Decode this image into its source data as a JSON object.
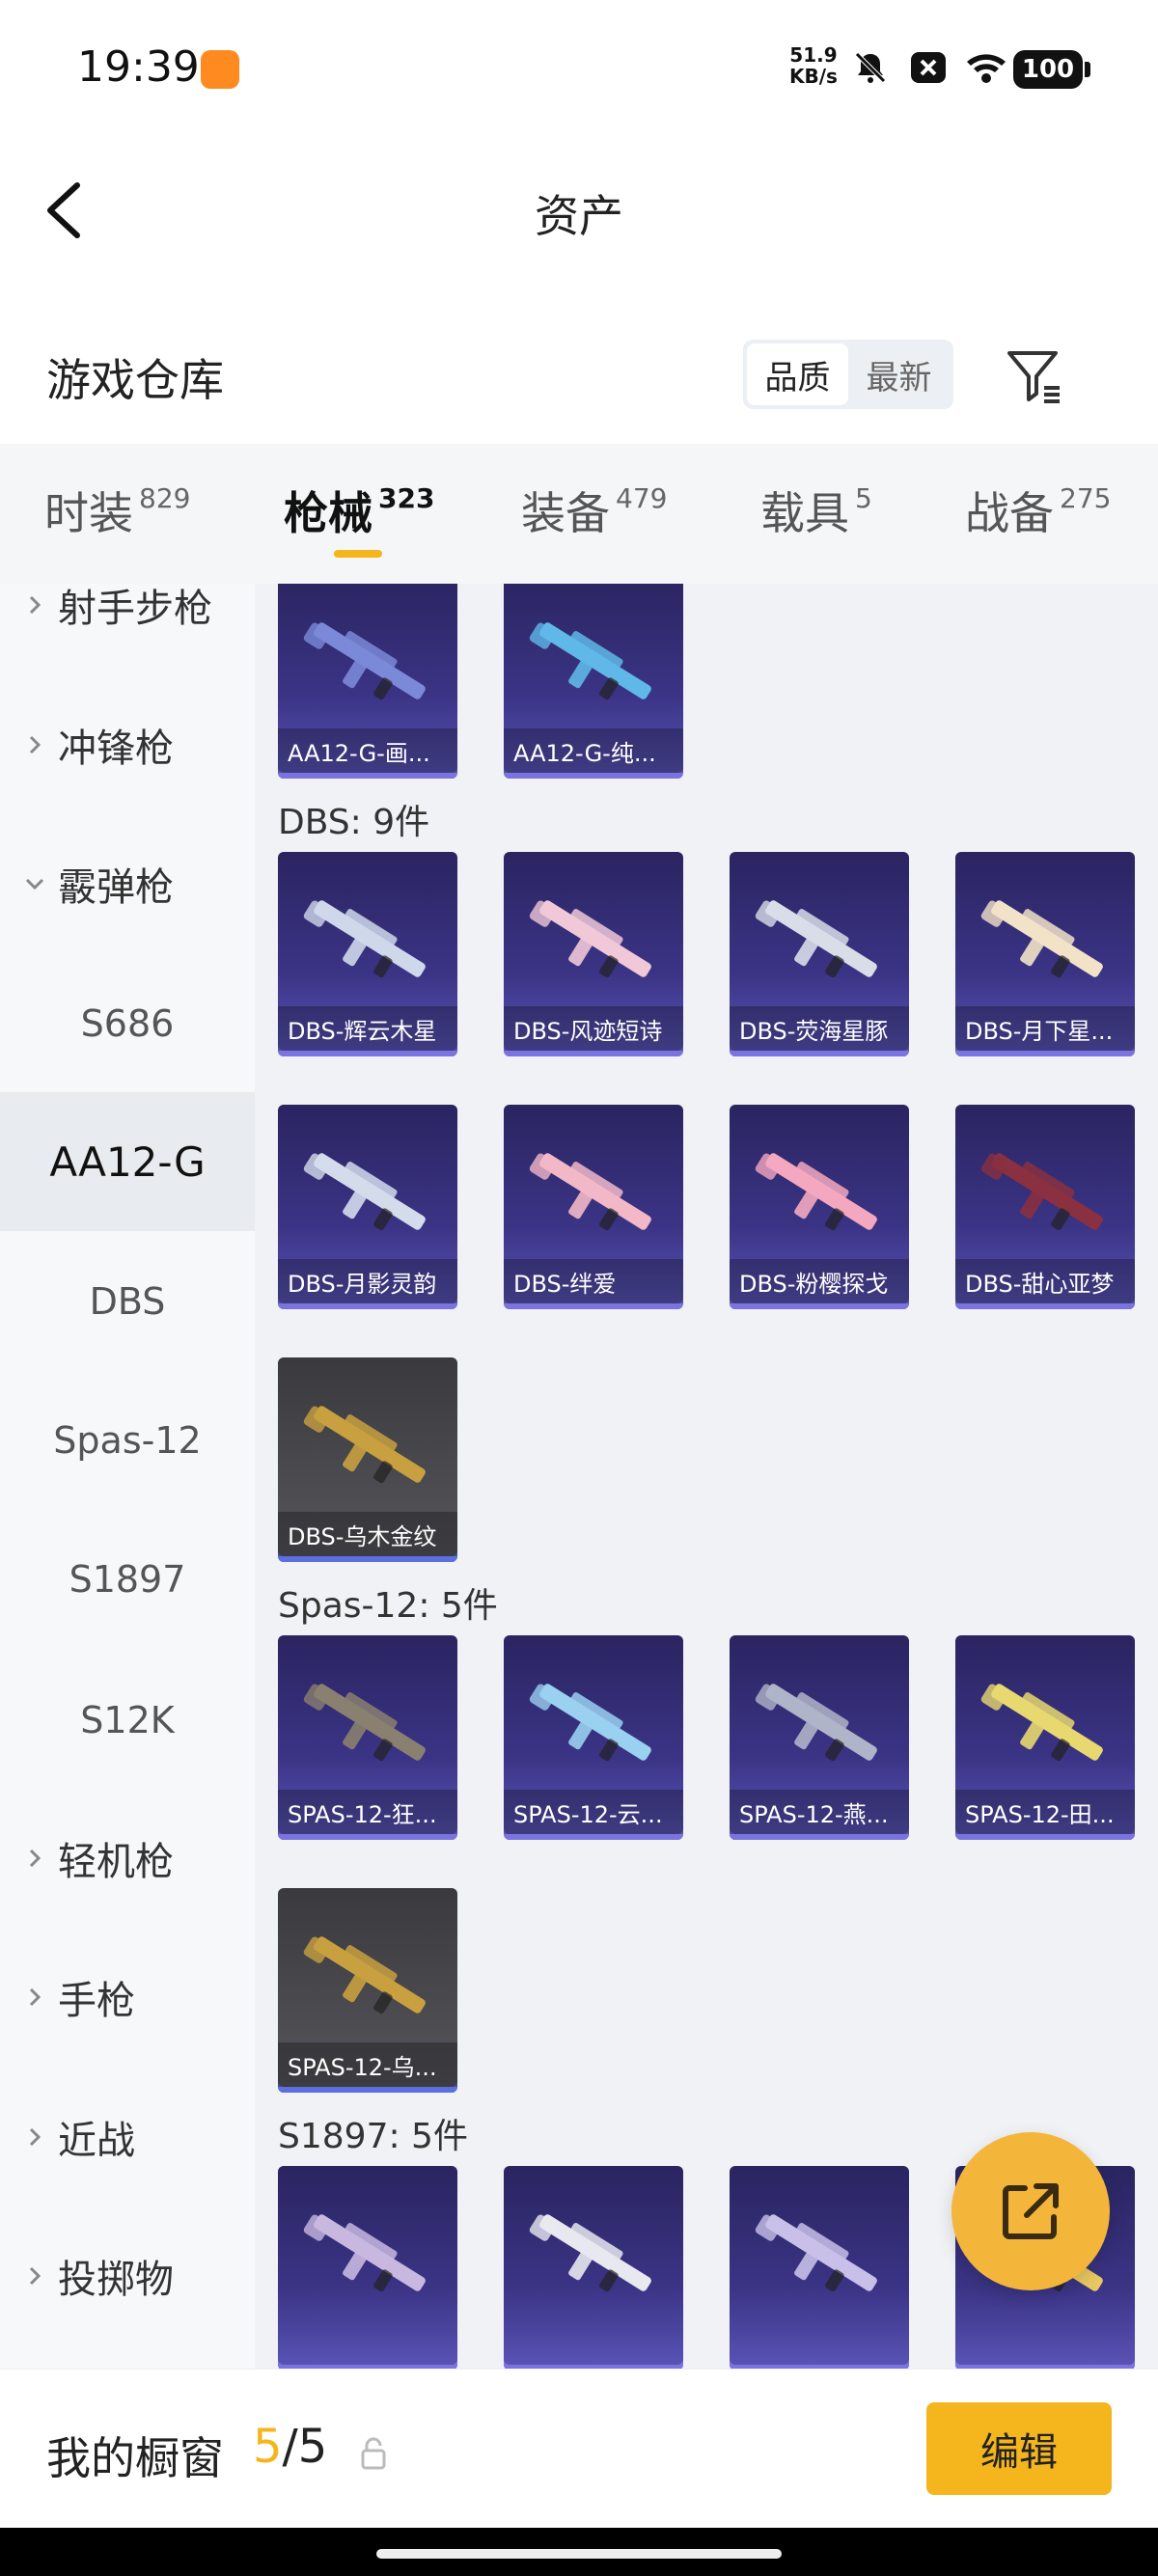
{
  "status_bar": {
    "time": "19:39",
    "speed_value": "51.9",
    "speed_unit": "KB/s",
    "battery": "100"
  },
  "nav": {
    "title": "资产"
  },
  "section": {
    "title": "游戏仓库",
    "sort_options": [
      "品质",
      "最新"
    ],
    "active_sort": "品质"
  },
  "tabs": [
    {
      "label": "时装",
      "count": "829"
    },
    {
      "label": "枪械",
      "count": "323",
      "active": true
    },
    {
      "label": "装备",
      "count": "479"
    },
    {
      "label": "载具",
      "count": "5"
    },
    {
      "label": "战备",
      "count": "275"
    }
  ],
  "sidebar": [
    {
      "label": "射手步枪",
      "type": "category",
      "expanded": false
    },
    {
      "label": "冲锋枪",
      "type": "category",
      "expanded": false
    },
    {
      "label": "霰弹枪",
      "type": "category",
      "expanded": true
    },
    {
      "label": "S686",
      "type": "sub"
    },
    {
      "label": "AA12-G",
      "type": "sub",
      "selected": true
    },
    {
      "label": "DBS",
      "type": "sub"
    },
    {
      "label": "Spas-12",
      "type": "sub"
    },
    {
      "label": "S1897",
      "type": "sub"
    },
    {
      "label": "S12K",
      "type": "sub"
    },
    {
      "label": "轻机枪",
      "type": "category",
      "expanded": false
    },
    {
      "label": "手枪",
      "type": "category",
      "expanded": false
    },
    {
      "label": "近战",
      "type": "category",
      "expanded": false
    },
    {
      "label": "投掷物",
      "type": "category",
      "expanded": false
    }
  ],
  "groups": [
    {
      "label": "",
      "items": [
        {
          "name": "AA12-G-画...",
          "style": "purple",
          "color": "#7a8ad8"
        },
        {
          "name": "AA12-G-纯...",
          "style": "purple",
          "color": "#5fb8e8"
        }
      ]
    },
    {
      "label": "DBS: 9件",
      "items": [
        {
          "name": "DBS-辉云木星",
          "style": "purple",
          "color": "#cfd8ea"
        },
        {
          "name": "DBS-风迹短诗",
          "style": "purple",
          "color": "#f0c8d8"
        },
        {
          "name": "DBS-荧海星豚",
          "style": "purple",
          "color": "#d8dde8"
        },
        {
          "name": "DBS-月下星...",
          "style": "purple",
          "color": "#f2e2c8"
        },
        {
          "name": "DBS-月影灵韵",
          "style": "purple",
          "color": "#d4dcec"
        },
        {
          "name": "DBS-绊爱",
          "style": "purple",
          "color": "#f2b8c8"
        },
        {
          "name": "DBS-粉樱探戈",
          "style": "purple",
          "color": "#f4a8c0"
        },
        {
          "name": "DBS-甜心亚梦",
          "style": "purple",
          "color": "#8a3040"
        },
        {
          "name": "DBS-乌木金纹",
          "style": "grey",
          "color": "#c8a040"
        }
      ]
    },
    {
      "label": "Spas-12: 5件",
      "items": [
        {
          "name": "SPAS-12-狂...",
          "style": "purple",
          "color": "#8a8070"
        },
        {
          "name": "SPAS-12-云...",
          "style": "purple",
          "color": "#9ad0f0"
        },
        {
          "name": "SPAS-12-燕...",
          "style": "purple",
          "color": "#b0b4c8"
        },
        {
          "name": "SPAS-12-田...",
          "style": "purple",
          "color": "#e8d870"
        },
        {
          "name": "SPAS-12-乌...",
          "style": "grey",
          "color": "#c8a040"
        }
      ]
    },
    {
      "label": "S1897: 5件",
      "items": [
        {
          "name": "",
          "style": "purple",
          "color": "#c8b8e0"
        },
        {
          "name": "",
          "style": "purple",
          "color": "#e8e8f0"
        },
        {
          "name": "",
          "style": "purple",
          "color": "#c8c0e8"
        },
        {
          "name": "",
          "style": "purple",
          "color": "#e8c860"
        }
      ]
    }
  ],
  "bottom_bar": {
    "label": "我的橱窗",
    "current": "5",
    "total": "/5",
    "edit_label": "编辑"
  },
  "colors": {
    "accent": "#f5b51c",
    "card_purple": "#3b3486",
    "card_grey": "#4a4a50"
  }
}
